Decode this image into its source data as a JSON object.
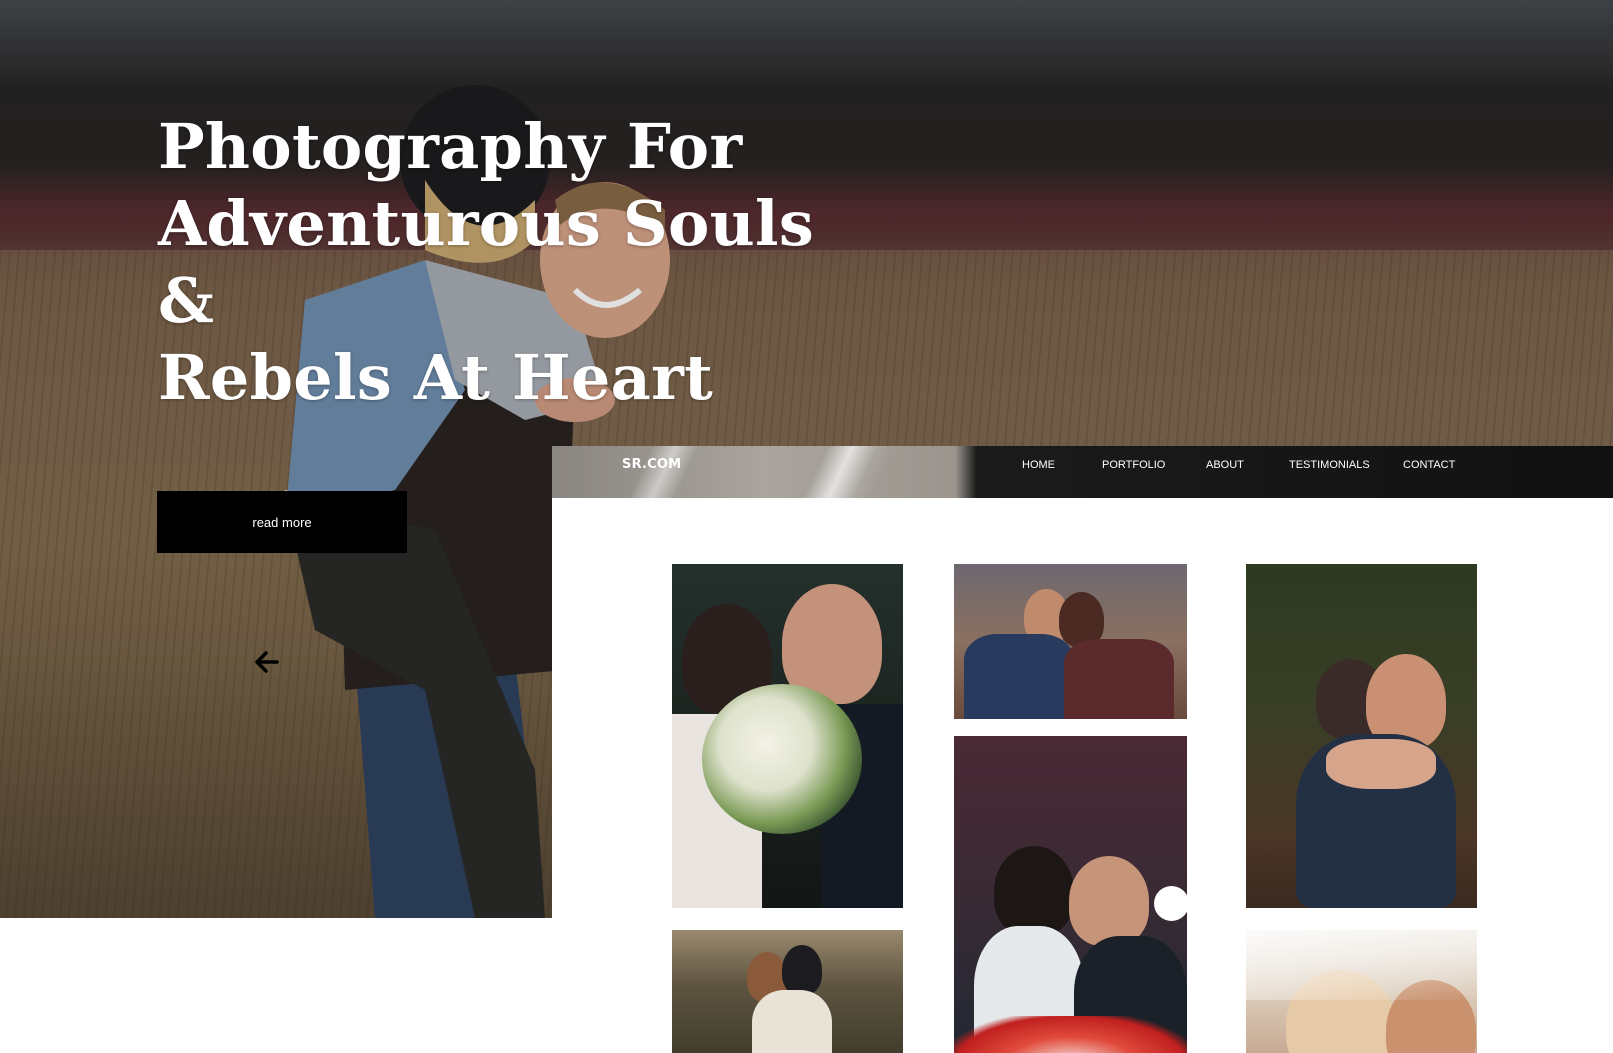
{
  "hero": {
    "title_line1": "Photography For",
    "title_line2": "Adventurous Souls &",
    "title_line3": "Rebels At Heart",
    "button_label": "read more",
    "arrow_icon": "arrow-left-icon"
  },
  "site": {
    "logo": "SR.COM",
    "nav": [
      "HOME",
      "PORTFOLIO",
      "ABOUT",
      "TESTIMONIALS",
      "CONTACT"
    ]
  },
  "colors": {
    "button_bg": "#000000",
    "header_bg": "#111111",
    "text_light": "#ffffff"
  }
}
